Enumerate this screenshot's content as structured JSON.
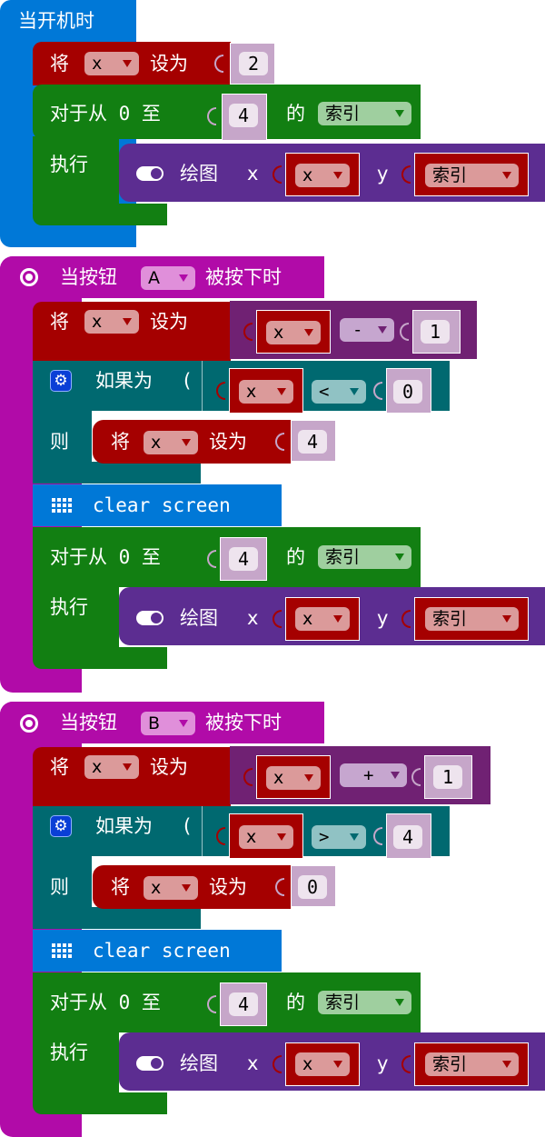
{
  "blocks": {
    "on_start": {
      "label": "当开机时",
      "set_var": {
        "prefix": "将",
        "var": "x",
        "mid": "设为",
        "value": "2"
      },
      "for_loop": {
        "label": "对于从 0 至",
        "to": "4",
        "of_label": "的",
        "index_var": "索引",
        "do_label": "执行",
        "plot": {
          "label": "绘图",
          "x_label": "x",
          "x_var": "x",
          "y_label": "y",
          "y_var": "索引"
        }
      }
    },
    "on_button_a": {
      "prefix": "当按钮",
      "button": "A",
      "suffix": "被按下时",
      "set_var": {
        "prefix": "将",
        "var": "x",
        "mid": "设为",
        "op_left": "x",
        "op": "-",
        "op_right": "1"
      },
      "if_block": {
        "label": "如果为",
        "cond_left": "x",
        "cond_op": "<",
        "cond_right": "0",
        "then_label": "则",
        "then_set": {
          "prefix": "将",
          "var": "x",
          "mid": "设为",
          "value": "4"
        }
      },
      "clear_screen": "clear screen",
      "for_loop": {
        "label": "对于从 0 至",
        "to": "4",
        "of_label": "的",
        "index_var": "索引",
        "do_label": "执行",
        "plot": {
          "label": "绘图",
          "x_label": "x",
          "x_var": "x",
          "y_label": "y",
          "y_var": "索引"
        }
      }
    },
    "on_button_b": {
      "prefix": "当按钮",
      "button": "B",
      "suffix": "被按下时",
      "set_var": {
        "prefix": "将",
        "var": "x",
        "mid": "设为",
        "op_left": "x",
        "op": "+",
        "op_right": "1"
      },
      "if_block": {
        "label": "如果为",
        "cond_left": "x",
        "cond_op": ">",
        "cond_right": "4",
        "then_label": "则",
        "then_set": {
          "prefix": "将",
          "var": "x",
          "mid": "设为",
          "value": "0"
        }
      },
      "clear_screen": "clear screen",
      "for_loop": {
        "label": "对于从 0 至",
        "to": "4",
        "of_label": "的",
        "index_var": "索引",
        "do_label": "执行",
        "plot": {
          "label": "绘图",
          "x_label": "x",
          "x_var": "x",
          "y_label": "y",
          "y_var": "索引"
        }
      }
    }
  },
  "colors": {
    "basic": "#0078d7",
    "input": "#b10ba8",
    "variables": "#a50000",
    "loops": "#127f12",
    "led": "#5c2d91",
    "math": "#702173",
    "logic": "#006970"
  }
}
